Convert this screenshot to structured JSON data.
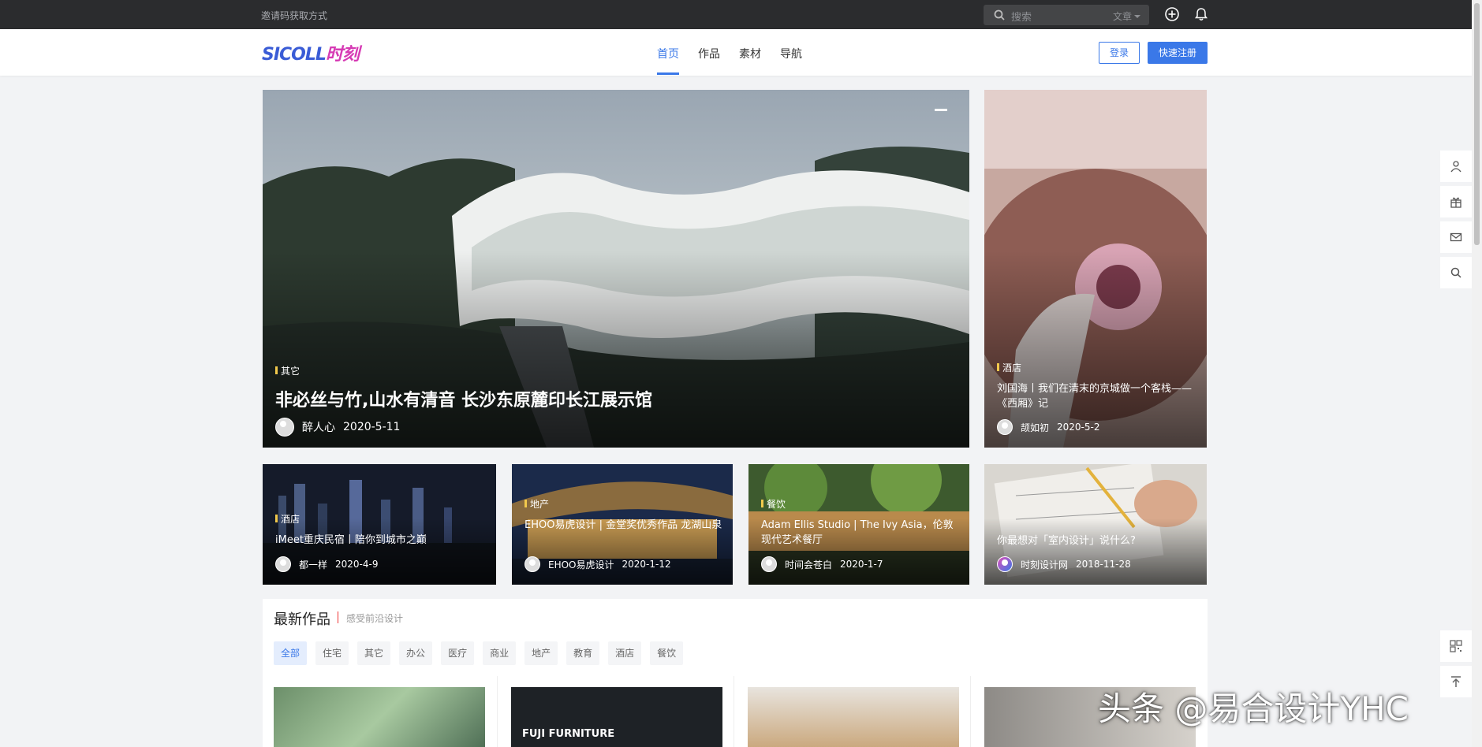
{
  "topbar": {
    "invite_link": "邀请码获取方式",
    "search_placeholder": "搜索",
    "search_type": "文章",
    "search_type_icon": "chevron-down-icon",
    "add_icon": "plus-circle-icon",
    "bell_icon": "bell-icon"
  },
  "header": {
    "logo_latin": "SICOLL",
    "logo_cn": "时刻",
    "nav": [
      {
        "label": "首页",
        "active": true
      },
      {
        "label": "作品",
        "active": false
      },
      {
        "label": "素材",
        "active": false
      },
      {
        "label": "导航",
        "active": false
      }
    ],
    "login_label": "登录",
    "register_label": "快速注册",
    "accent_color": "#3a78e8"
  },
  "hero": {
    "main": {
      "tag": "其它",
      "title": "非必丝与竹,山水有清音 长沙东原麓印长江展示馆",
      "author": "醉人心",
      "date": "2020-5-11"
    },
    "side": {
      "tag": "酒店",
      "title": "刘国海丨我们在清末的京城做一个客栈——《西厢》记",
      "author": "颉如初",
      "date": "2020-5-2"
    }
  },
  "cards": [
    {
      "tag": "酒店",
      "title": "iMeet重庆民宿丨陪你到城市之巅",
      "author": "都一样",
      "date": "2020-4-9"
    },
    {
      "tag": "地产",
      "title": "EHOO易虎设计 | 金堂奖优秀作品 龙湖山泉",
      "author": "EHOO易虎设计",
      "date": "2020-1-12"
    },
    {
      "tag": "餐饮",
      "title": "Adam Ellis Studio | The Ivy Asia，伦敦现代艺术餐厅",
      "author": "时间会苍白",
      "date": "2020-1-7"
    },
    {
      "tag": "",
      "title": "你最想对「室内设计」说什么?",
      "author": "时刻设计网",
      "date": "2018-11-28"
    }
  ],
  "latest": {
    "heading": "最新作品",
    "subheading": "感受前沿设计",
    "filters": [
      "全部",
      "住宅",
      "其它",
      "办公",
      "医疗",
      "商业",
      "地产",
      "教育",
      "酒店",
      "餐饮"
    ],
    "thumb_caption": "FUJI FURNITURE"
  },
  "float_tools": [
    "user-icon",
    "gift-icon",
    "mail-icon",
    "search-icon"
  ],
  "bottom_tools": [
    "qrcode-icon",
    "back-to-top-icon"
  ],
  "watermark": "头条 @易合设计YHC"
}
